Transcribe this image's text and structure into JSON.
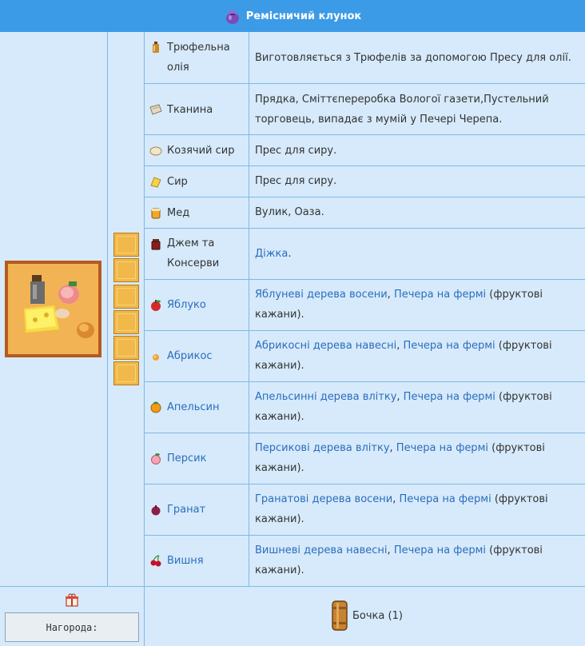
{
  "header": {
    "title": "Ремісничий клунок",
    "icon": "purple-bundle-icon"
  },
  "items": [
    {
      "name_lines": [
        "Трюфельна",
        "олія"
      ],
      "icon": "truffle-oil-bottle-icon",
      "name_is_link": false,
      "desc": [
        {
          "text": "Виготовляється з Трюфелів за допомогою Пресу для олії.",
          "link": false
        }
      ]
    },
    {
      "name_lines": [
        "Тканина"
      ],
      "icon": "cloth-icon",
      "name_is_link": false,
      "desc": [
        {
          "text": "Прядка, Сміттєпереробка Вологої газети,Пустельний торговець, випадає з мумій у Печері Черепа.",
          "link": false
        }
      ]
    },
    {
      "name_lines": [
        "Козячий сир"
      ],
      "icon": "goat-cheese-icon",
      "name_is_link": false,
      "desc": [
        {
          "text": "Прес для сиру.",
          "link": false
        }
      ]
    },
    {
      "name_lines": [
        "Сир"
      ],
      "icon": "cheese-icon",
      "name_is_link": false,
      "desc": [
        {
          "text": "Прес для сиру.",
          "link": false
        }
      ]
    },
    {
      "name_lines": [
        "Мед"
      ],
      "icon": "honey-jar-icon",
      "name_is_link": false,
      "desc": [
        {
          "text": "Вулик, Оаза.",
          "link": false
        }
      ]
    },
    {
      "name_lines": [
        "Джем та",
        "Консерви"
      ],
      "icon": "jam-jar-icon",
      "name_is_link": false,
      "desc": [
        {
          "text": "Діжка",
          "link": true
        },
        {
          "text": ".",
          "link": false
        }
      ]
    },
    {
      "name_lines": [
        "Яблуко"
      ],
      "icon": "apple-icon",
      "name_is_link": true,
      "desc": [
        {
          "text": "Яблуневі дерева восени",
          "link": true
        },
        {
          "text": ", ",
          "link": false
        },
        {
          "text": "Печера на фермі",
          "link": true
        },
        {
          "text": " (фруктові кажани).",
          "link": false
        }
      ]
    },
    {
      "name_lines": [
        "Абрикос"
      ],
      "icon": "apricot-icon",
      "name_is_link": true,
      "desc": [
        {
          "text": "Абрикосні дерева навесні",
          "link": true
        },
        {
          "text": ", ",
          "link": false
        },
        {
          "text": "Печера на фермі",
          "link": true
        },
        {
          "text": " (фруктові кажани).",
          "link": false
        }
      ]
    },
    {
      "name_lines": [
        "Апельсин"
      ],
      "icon": "orange-icon",
      "name_is_link": true,
      "desc": [
        {
          "text": "Апельсинні дерева влітку",
          "link": true
        },
        {
          "text": ", ",
          "link": false
        },
        {
          "text": "Печера на фермі",
          "link": true
        },
        {
          "text": " (фруктові кажани).",
          "link": false
        }
      ]
    },
    {
      "name_lines": [
        "Персик"
      ],
      "icon": "peach-icon",
      "name_is_link": true,
      "desc": [
        {
          "text": "Персикові дерева влітку",
          "link": true
        },
        {
          "text": ", ",
          "link": false
        },
        {
          "text": "Печера на фермі",
          "link": true
        },
        {
          "text": " (фруктові кажани).",
          "link": false
        }
      ]
    },
    {
      "name_lines": [
        "Гранат"
      ],
      "icon": "pomegranate-icon",
      "name_is_link": true,
      "desc": [
        {
          "text": "Гранатові дерева восени",
          "link": true
        },
        {
          "text": ", ",
          "link": false
        },
        {
          "text": "Печера на фермі",
          "link": true
        },
        {
          "text": " (фруктові кажани).",
          "link": false
        }
      ]
    },
    {
      "name_lines": [
        "Вишня"
      ],
      "icon": "cherry-icon",
      "name_is_link": true,
      "desc": [
        {
          "text": "Вишневі дерева навесні",
          "link": true
        },
        {
          "text": ", ",
          "link": false
        },
        {
          "text": "Печера на фермі",
          "link": true
        },
        {
          "text": " (фруктові кажани).",
          "link": false
        }
      ]
    }
  ],
  "slots": {
    "count": 6
  },
  "reward": {
    "label": "Нагорода:",
    "icon": "gift-icon",
    "item_label": "Бочка (1)",
    "item_icon": "keg-icon"
  },
  "colors": {
    "header": "#3c9be7",
    "cell_bg": "#d6eafb",
    "border": "#7fb8e6",
    "link": "#2c6dbc",
    "slot": "#f0b94a"
  }
}
